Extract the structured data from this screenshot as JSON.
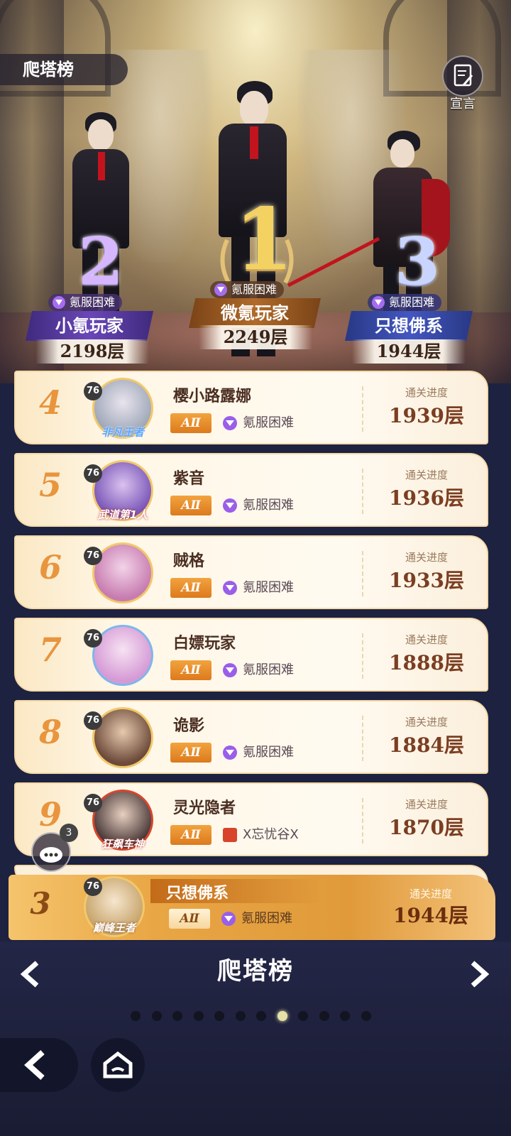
{
  "header": {
    "title": "爬塔榜",
    "declare_label": "宣言"
  },
  "podium": [
    {
      "rank": "2",
      "name": "小氪玩家",
      "difficulty": "氪服困难",
      "floor": "2198层"
    },
    {
      "rank": "1",
      "name": "微氪玩家",
      "difficulty": "氪服困难",
      "floor": "2249层"
    },
    {
      "rank": "3",
      "name": "只想佛系",
      "difficulty": "氪服困难",
      "floor": "1944层"
    }
  ],
  "list": [
    {
      "rank": "4",
      "level": "76",
      "frame": "非凡王者",
      "name": "樱小路露娜",
      "grade": "AⅡ",
      "server": "氪服困难",
      "progress_label": "通关进度",
      "floor": "1939层"
    },
    {
      "rank": "5",
      "level": "76",
      "frame": "武道第1人",
      "name": "紫音",
      "grade": "AⅡ",
      "server": "氪服困难",
      "progress_label": "通关进度",
      "floor": "1936层"
    },
    {
      "rank": "6",
      "level": "76",
      "frame": "",
      "name": "贼格",
      "grade": "AⅡ",
      "server": "氪服困难",
      "progress_label": "通关进度",
      "floor": "1933层"
    },
    {
      "rank": "7",
      "level": "76",
      "frame": "",
      "name": "白嫖玩家",
      "grade": "AⅡ",
      "server": "氪服困难",
      "progress_label": "通关进度",
      "floor": "1888层"
    },
    {
      "rank": "8",
      "level": "76",
      "frame": "",
      "name": "诡影",
      "grade": "AⅡ",
      "server": "氪服困难",
      "progress_label": "通关进度",
      "floor": "1884层"
    },
    {
      "rank": "9",
      "level": "76",
      "frame": "狂飙车神",
      "name": "灵光隐者",
      "grade": "AⅡ",
      "server": "X忘忧谷X",
      "progress_label": "通关进度",
      "floor": "1870层"
    }
  ],
  "me": {
    "rank": "3",
    "level": "76",
    "frame": "巅峰王者",
    "name": "只想佛系",
    "grade": "AⅡ",
    "server": "氪服困难",
    "progress_label": "通关进度",
    "floor": "1944层"
  },
  "chat": {
    "count": "3"
  },
  "footer": {
    "board_title": "爬塔榜",
    "page_count": 12,
    "active_page": 8
  },
  "icons": {
    "declare": "edit-note-icon",
    "chat": "chat-bubble-icon",
    "prev": "chevron-left-icon",
    "next": "chevron-right-icon",
    "back": "back-arrow-icon",
    "home": "home-icon",
    "server": "gem-icon"
  },
  "colors": {
    "accent_orange": "#e8953e",
    "floor_text": "#7b3e22",
    "purple_plate": "#5a3d9e",
    "gold_plate": "#9a5a22",
    "blue_plate": "#3a4aa8",
    "footer_bg": "#232646"
  }
}
